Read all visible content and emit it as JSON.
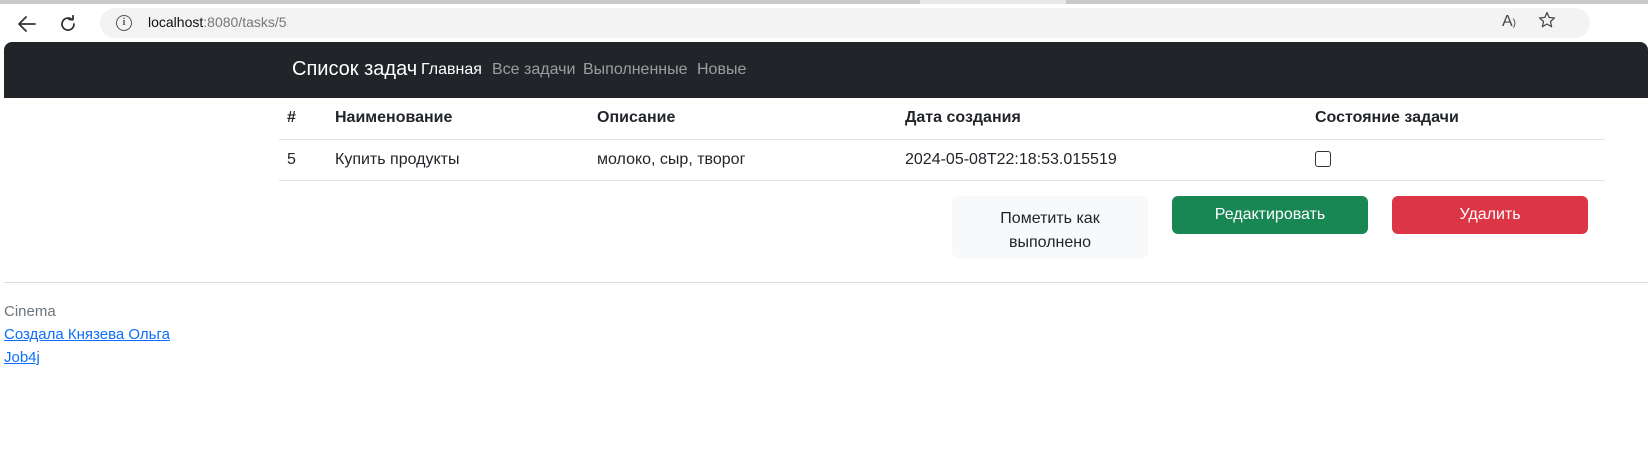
{
  "browser": {
    "url_host": "localhost",
    "url_rest": ":8080/tasks/5",
    "info_icon": "info-icon",
    "back_icon": "back-arrow-icon",
    "reload_icon": "reload-icon",
    "read_aloud_icon": "read-aloud-icon",
    "favorite_icon": "star-icon"
  },
  "navbar": {
    "brand": "Список задач",
    "links": [
      {
        "label": "Главная",
        "active": true
      },
      {
        "label": "Все задачи",
        "active": false
      },
      {
        "label": "Выполненные",
        "active": false
      },
      {
        "label": "Новые",
        "active": false
      }
    ]
  },
  "table": {
    "headers": [
      "#",
      "Наименование",
      "Описание",
      "Дата создания",
      "Состояние задачи"
    ],
    "row": {
      "id": "5",
      "name": "Купить продукты",
      "description": "молоко, сыр, творог",
      "created": "2024-05-08T22:18:53.015519",
      "done": false
    }
  },
  "actions": {
    "mark_done": "Пометить как выполнено",
    "edit": "Редактировать",
    "delete": "Удалить"
  },
  "footer": {
    "title": "Cinema",
    "author_link": "Создала Князева Ольга",
    "job4j_link": "Job4j"
  },
  "colors": {
    "navbar_bg": "#212529",
    "success": "#198754",
    "danger": "#dc3545",
    "link": "#0d6efd"
  }
}
